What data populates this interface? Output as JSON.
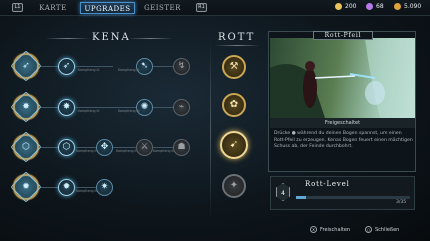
{
  "topbar": {
    "key_left": "L1",
    "key_right": "R1",
    "tabs": [
      {
        "label": "KARTE"
      },
      {
        "label": "UPGRADES"
      },
      {
        "label": "GEISTER"
      }
    ],
    "currencies": [
      {
        "value": "200",
        "icon": "coin-icon",
        "color": "#e8c45a"
      },
      {
        "value": "68",
        "icon": "gem-icon",
        "color": "#b57be8"
      },
      {
        "value": "5.090",
        "icon": "karma-icon",
        "color": "#e0a23a"
      }
    ]
  },
  "kena": {
    "title": "KENA",
    "rows": [
      {
        "base_icon": "bow-icon",
        "nodes": [
          {
            "glyph": "➶",
            "locked": false
          },
          {
            "glyph": "➷",
            "locked": false
          },
          {
            "glyph": "↯",
            "locked": true
          }
        ],
        "connectors": [
          "Kampfrang III",
          "Kampfrang III"
        ]
      },
      {
        "base_icon": "staff-icon",
        "nodes": [
          {
            "glyph": "✸",
            "locked": false
          },
          {
            "glyph": "✺",
            "locked": false
          },
          {
            "glyph": "⌁",
            "locked": true
          }
        ],
        "connectors": [
          "Kampfrang III",
          "Kampfrang III"
        ]
      },
      {
        "base_icon": "shield-icon",
        "nodes": [
          {
            "glyph": "⬡",
            "locked": false
          },
          {
            "glyph": "✥",
            "locked": false
          },
          {
            "glyph": "⚔",
            "locked": true
          },
          {
            "glyph": "☗",
            "locked": true
          }
        ],
        "connectors": [
          "Kampfrang II",
          "Kampfrang II",
          "Kampfrang III"
        ]
      },
      {
        "base_icon": "bomb-icon",
        "nodes": [
          {
            "glyph": "✹",
            "locked": false
          },
          {
            "glyph": "✷",
            "locked": false
          }
        ],
        "connectors": [
          "Kampfrang III"
        ]
      }
    ]
  },
  "rott": {
    "title": "ROTT",
    "items": [
      {
        "glyph": "⚒"
      },
      {
        "glyph": "✿"
      },
      {
        "glyph": "➹"
      },
      {
        "glyph": "✦"
      }
    ]
  },
  "detail": {
    "title": "Rott-Pfeil",
    "status": "Freigeschaltet",
    "description": "Drücke ● während du deinen Bogen spannst, um einen Rott-Pfeil zu erzeugen. Kenas Bogen feuert einen mächtigen Schuss ab, der Feinde durchbohrt."
  },
  "level": {
    "title": "Rott-Level",
    "level": "4",
    "progress_text": "3/35",
    "progress": 0.09
  },
  "hints": {
    "unlock": "Freischalten",
    "close": "Schließen"
  }
}
